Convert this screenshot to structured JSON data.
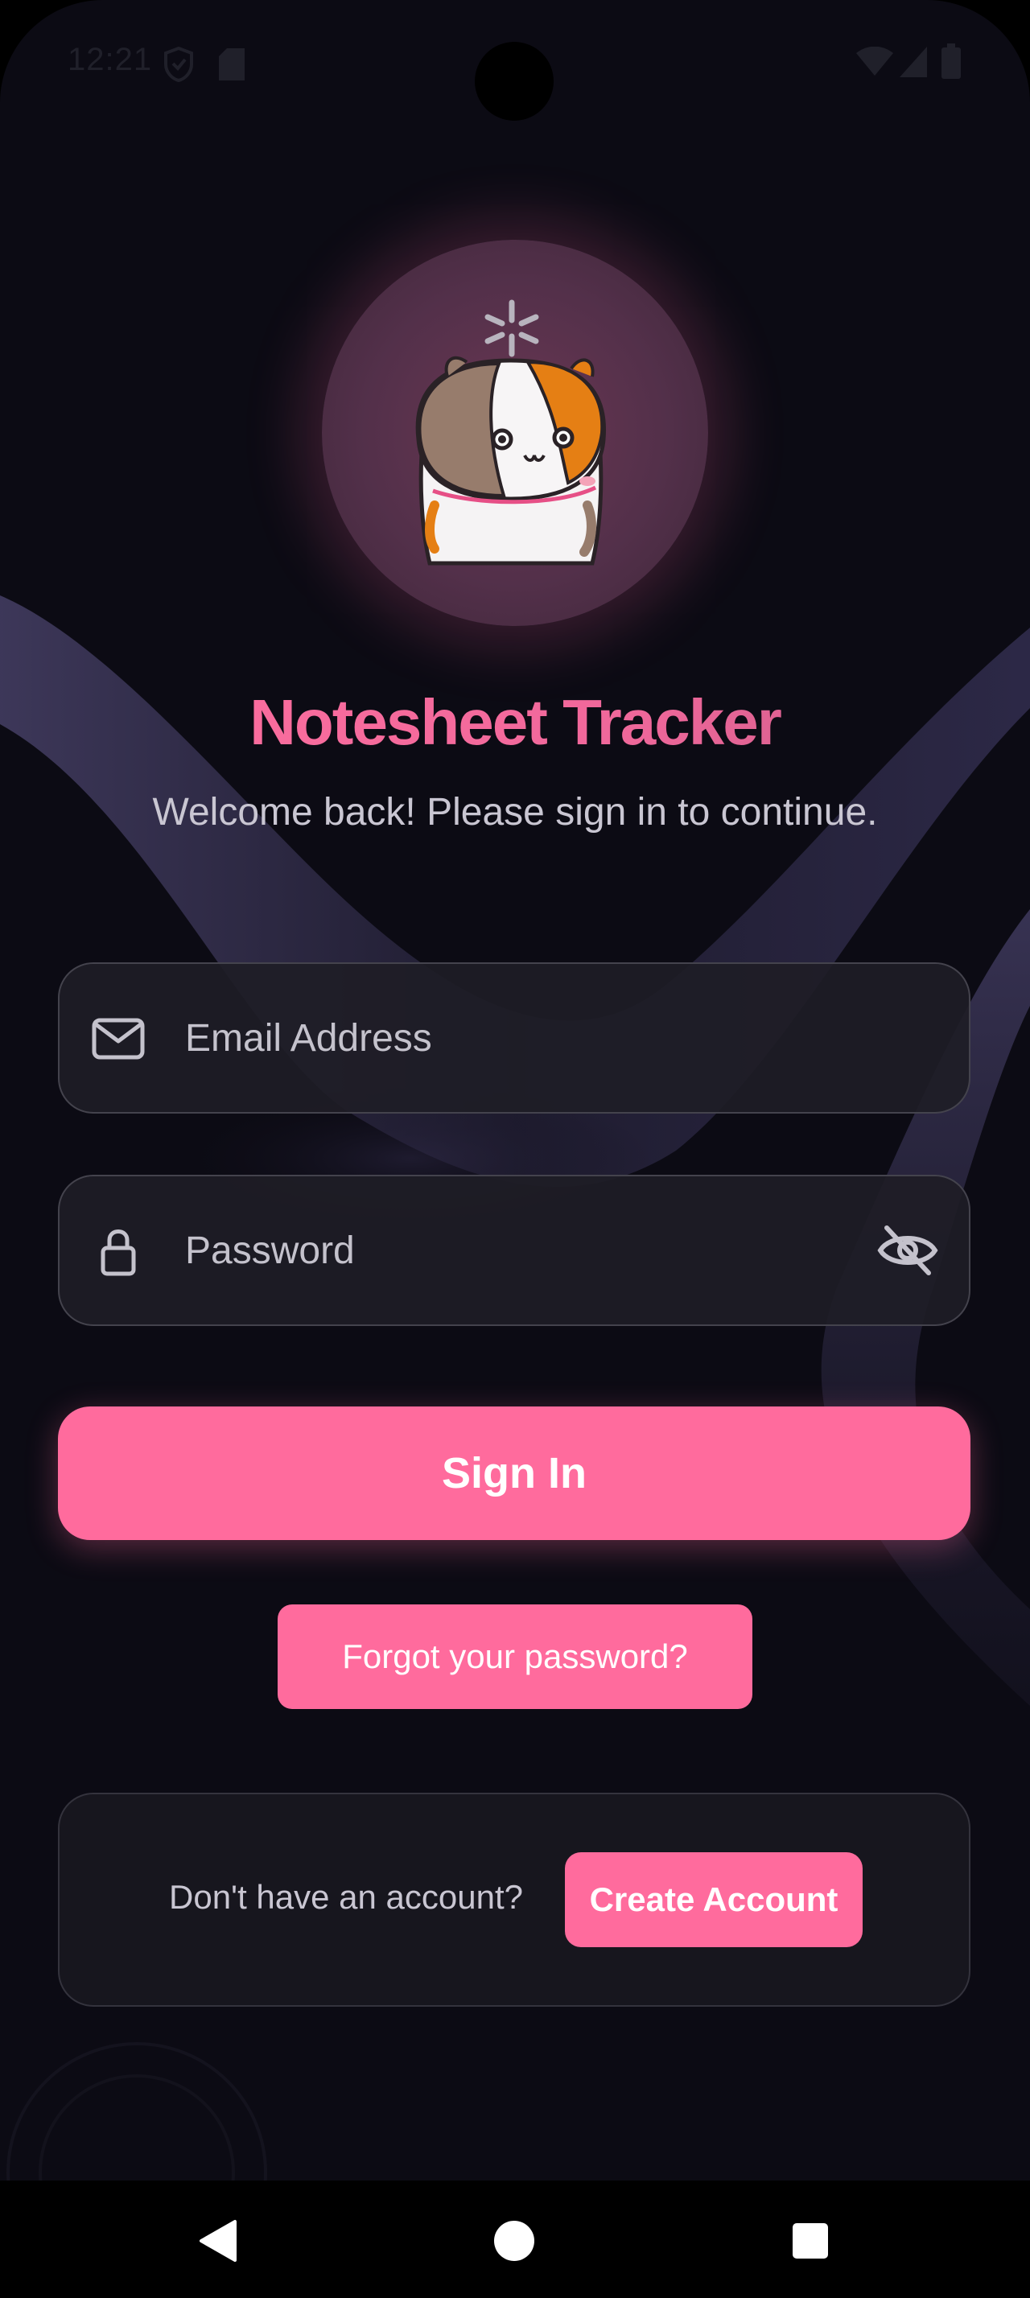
{
  "status_bar": {
    "time": "12:21",
    "icons": [
      "shield-icon",
      "sd-card-icon",
      "wifi-icon",
      "signal-icon",
      "battery-icon"
    ]
  },
  "mascot": {
    "icon": "hamster-mascot-icon",
    "accent_color": "#ff6b9d"
  },
  "header": {
    "title": "Notesheet Tracker",
    "subtitle": "Welcome back! Please sign in to continue."
  },
  "form": {
    "email": {
      "placeholder": "Email Address",
      "value": "",
      "icon": "mail-icon"
    },
    "password": {
      "placeholder": "Password",
      "value": "",
      "icon": "lock-icon",
      "toggle_icon": "eye-off-icon"
    },
    "signin_label": "Sign In",
    "forgot_label": "Forgot your password?"
  },
  "account": {
    "prompt": "Don't have an account?",
    "create_label": "Create Account"
  },
  "nav_bar": {
    "icons": [
      "back-icon",
      "home-icon",
      "recents-icon"
    ]
  },
  "colors": {
    "accent": "#ff6b9d",
    "background": "#0c0b14",
    "field_background": "#1e1d26",
    "text_muted": "#c9c6d2"
  }
}
